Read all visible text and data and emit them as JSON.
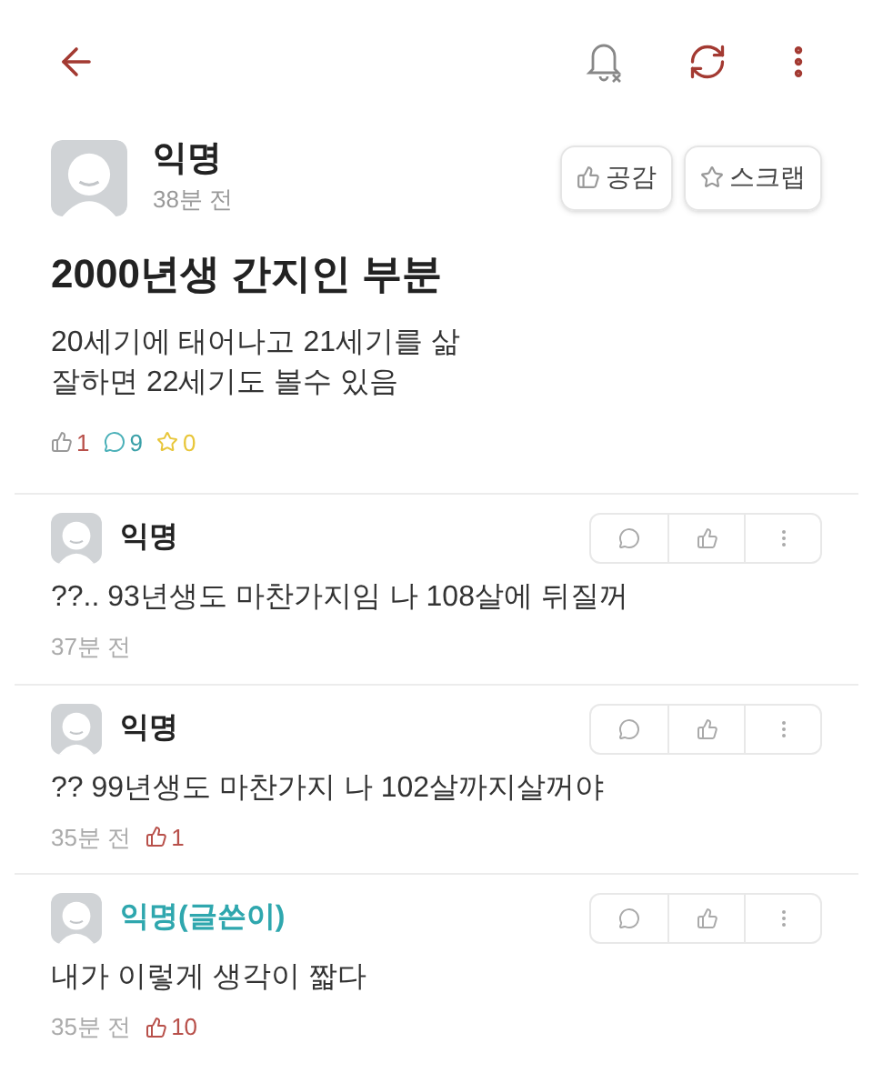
{
  "post": {
    "author": "익명",
    "time": "38분 전",
    "actions": [
      {
        "kind": "like",
        "label": "공감"
      },
      {
        "kind": "scrap",
        "label": "스크랩"
      }
    ],
    "title": "2000년생 간지인 부분",
    "body": [
      "20세기에 태어나고 21세기를 삶",
      "잘하면 22세기도 볼수 있음"
    ],
    "stats": {
      "likes": "1",
      "comments": "9",
      "scraps": "0"
    }
  },
  "comments": [
    {
      "author": "익명",
      "is_post_author": false,
      "text": "??.. 93년생도 마찬가지임 나 108살에 뒤질꺼",
      "time": "37분 전"
    },
    {
      "author": "익명",
      "is_post_author": false,
      "text": "?? 99년생도 마찬가지 나 102살까지살꺼야",
      "time": "35분 전",
      "likes": "1"
    },
    {
      "author": "익명(글쓴이)",
      "is_post_author": true,
      "text": "내가 이렇게 생각이 짧다",
      "time": "35분 전",
      "likes": "10"
    }
  ]
}
